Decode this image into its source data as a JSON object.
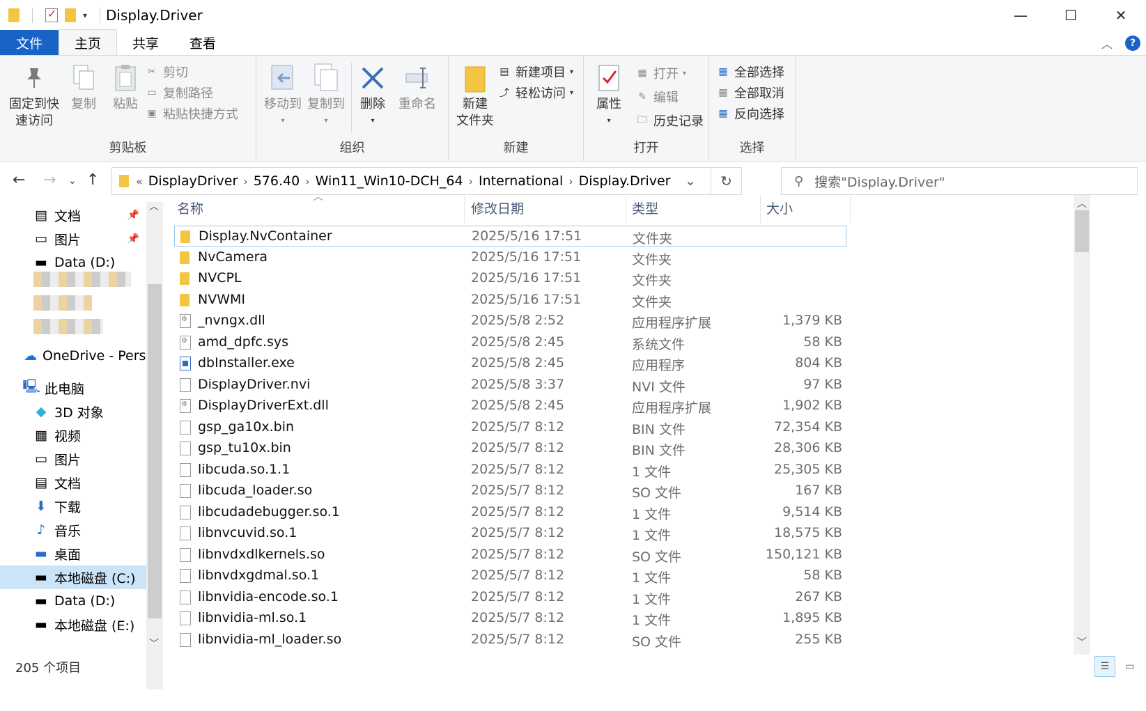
{
  "window": {
    "title": "Display.Driver",
    "minimize": "—",
    "maximize": "☐",
    "close": "✕"
  },
  "ribbon_tabs": [
    "文件",
    "主页",
    "共享",
    "查看"
  ],
  "ribbon": {
    "clipboard": {
      "label": "剪贴板",
      "pin": "固定到快\n速访问",
      "pin_l1": "固定到快",
      "pin_l2": "速访问",
      "copy": "复制",
      "paste": "粘贴",
      "cut": "剪切",
      "copy_path": "复制路径",
      "paste_shortcut": "粘贴快捷方式"
    },
    "organize": {
      "label": "组织",
      "move_to": "移动到",
      "copy_to": "复制到",
      "delete": "删除",
      "rename": "重命名"
    },
    "new": {
      "label": "新建",
      "new_folder_l1": "新建",
      "new_folder_l2": "文件夹",
      "new_item": "新建项目",
      "easy_access": "轻松访问"
    },
    "open": {
      "label": "打开",
      "properties": "属性",
      "open": "打开",
      "edit": "编辑",
      "history": "历史记录"
    },
    "select": {
      "label": "选择",
      "select_all": "全部选择",
      "select_none": "全部取消",
      "invert": "反向选择"
    }
  },
  "address": {
    "breadcrumbs": [
      "DisplayDriver",
      "576.40",
      "Win11_Win10-DCH_64",
      "International",
      "Display.Driver"
    ],
    "overflow": "«"
  },
  "search": {
    "placeholder": "搜索\"Display.Driver\""
  },
  "nav": {
    "quick": [
      {
        "label": "文档",
        "pinned": true
      },
      {
        "label": "图片",
        "pinned": true
      },
      {
        "label": "Data (D:)",
        "pinned": false
      }
    ],
    "onedrive": "OneDrive - Perso",
    "this_pc": "此电脑",
    "pc_items": [
      "3D 对象",
      "视频",
      "图片",
      "文档",
      "下载",
      "音乐",
      "桌面",
      "本地磁盘 (C:)",
      "Data (D:)",
      "本地磁盘 (E:)"
    ]
  },
  "columns": {
    "name": "名称",
    "date": "修改日期",
    "type": "类型",
    "size": "大小"
  },
  "files": [
    {
      "name": "Display.NvContainer",
      "date": "2025/5/16 17:51",
      "type": "文件夹",
      "size": "",
      "icon": "folder"
    },
    {
      "name": "NvCamera",
      "date": "2025/5/16 17:51",
      "type": "文件夹",
      "size": "",
      "icon": "folder"
    },
    {
      "name": "NVCPL",
      "date": "2025/5/16 17:51",
      "type": "文件夹",
      "size": "",
      "icon": "folder"
    },
    {
      "name": "NVWMI",
      "date": "2025/5/16 17:51",
      "type": "文件夹",
      "size": "",
      "icon": "folder"
    },
    {
      "name": "_nvngx.dll",
      "date": "2025/5/8 2:52",
      "type": "应用程序扩展",
      "size": "1,379 KB",
      "icon": "dll"
    },
    {
      "name": "amd_dpfc.sys",
      "date": "2025/5/8 2:45",
      "type": "系统文件",
      "size": "58 KB",
      "icon": "dll"
    },
    {
      "name": "dbInstaller.exe",
      "date": "2025/5/8 2:45",
      "type": "应用程序",
      "size": "804 KB",
      "icon": "exe"
    },
    {
      "name": "DisplayDriver.nvi",
      "date": "2025/5/8 3:37",
      "type": "NVI 文件",
      "size": "97 KB",
      "icon": "file"
    },
    {
      "name": "DisplayDriverExt.dll",
      "date": "2025/5/8 2:45",
      "type": "应用程序扩展",
      "size": "1,902 KB",
      "icon": "dll"
    },
    {
      "name": "gsp_ga10x.bin",
      "date": "2025/5/7 8:12",
      "type": "BIN 文件",
      "size": "72,354 KB",
      "icon": "file"
    },
    {
      "name": "gsp_tu10x.bin",
      "date": "2025/5/7 8:12",
      "type": "BIN 文件",
      "size": "28,306 KB",
      "icon": "file"
    },
    {
      "name": "libcuda.so.1.1",
      "date": "2025/5/7 8:12",
      "type": "1 文件",
      "size": "25,305 KB",
      "icon": "file"
    },
    {
      "name": "libcuda_loader.so",
      "date": "2025/5/7 8:12",
      "type": "SO 文件",
      "size": "167 KB",
      "icon": "file"
    },
    {
      "name": "libcudadebugger.so.1",
      "date": "2025/5/7 8:12",
      "type": "1 文件",
      "size": "9,514 KB",
      "icon": "file"
    },
    {
      "name": "libnvcuvid.so.1",
      "date": "2025/5/7 8:12",
      "type": "1 文件",
      "size": "18,575 KB",
      "icon": "file"
    },
    {
      "name": "libnvdxdlkernels.so",
      "date": "2025/5/7 8:12",
      "type": "SO 文件",
      "size": "150,121 KB",
      "icon": "file"
    },
    {
      "name": "libnvdxgdmal.so.1",
      "date": "2025/5/7 8:12",
      "type": "1 文件",
      "size": "58 KB",
      "icon": "file"
    },
    {
      "name": "libnvidia-encode.so.1",
      "date": "2025/5/7 8:12",
      "type": "1 文件",
      "size": "267 KB",
      "icon": "file"
    },
    {
      "name": "libnvidia-ml.so.1",
      "date": "2025/5/7 8:12",
      "type": "1 文件",
      "size": "1,895 KB",
      "icon": "file"
    },
    {
      "name": "libnvidia-ml_loader.so",
      "date": "2025/5/7 8:12",
      "type": "SO 文件",
      "size": "255 KB",
      "icon": "file"
    }
  ],
  "status": {
    "count": "205 个项目"
  }
}
